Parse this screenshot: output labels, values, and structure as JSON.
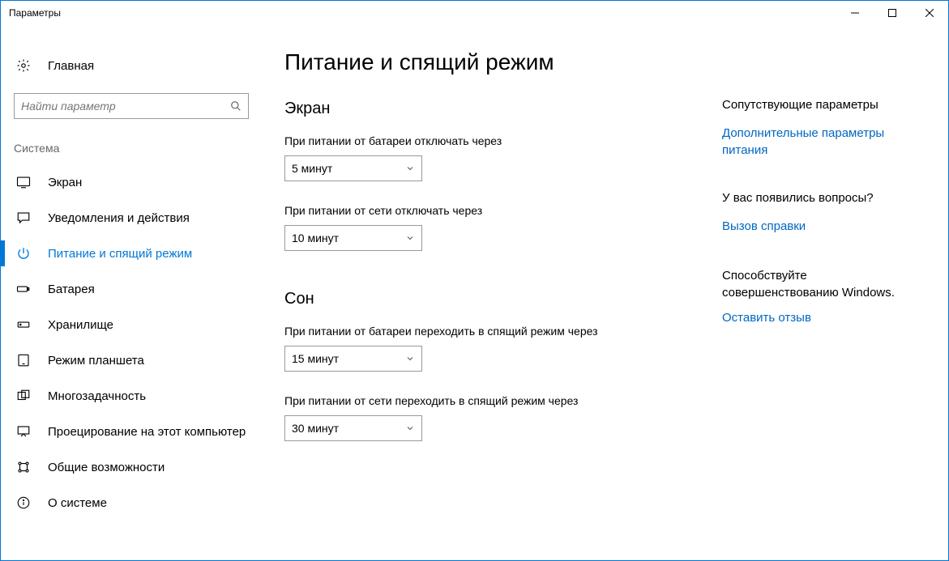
{
  "window": {
    "title": "Параметры"
  },
  "sidebar": {
    "home": "Главная",
    "search_placeholder": "Найти параметр",
    "section": "Система",
    "items": [
      {
        "label": "Экран"
      },
      {
        "label": "Уведомления и действия"
      },
      {
        "label": "Питание и спящий режим"
      },
      {
        "label": "Батарея"
      },
      {
        "label": "Хранилище"
      },
      {
        "label": "Режим планшета"
      },
      {
        "label": "Многозадачность"
      },
      {
        "label": "Проецирование на этот компьютер"
      },
      {
        "label": "Общие возможности"
      },
      {
        "label": "О системе"
      }
    ]
  },
  "main": {
    "title": "Питание и спящий режим",
    "section1": "Экран",
    "s1a_label": "При питании от батареи отключать через",
    "s1a_value": "5 минут",
    "s1b_label": "При питании от сети отключать через",
    "s1b_value": "10 минут",
    "section2": "Сон",
    "s2a_label": "При питании от батареи переходить в спящий режим через",
    "s2a_value": "15 минут",
    "s2b_label": "При питании от сети переходить в спящий режим через",
    "s2b_value": "30 минут"
  },
  "aside": {
    "related_title": "Сопутствующие параметры",
    "related_link": "Дополнительные параметры питания",
    "questions_title": "У вас появились вопросы?",
    "questions_link": "Вызов справки",
    "improve_text": "Способствуйте совершенствованию Windows.",
    "improve_link": "Оставить отзыв"
  }
}
